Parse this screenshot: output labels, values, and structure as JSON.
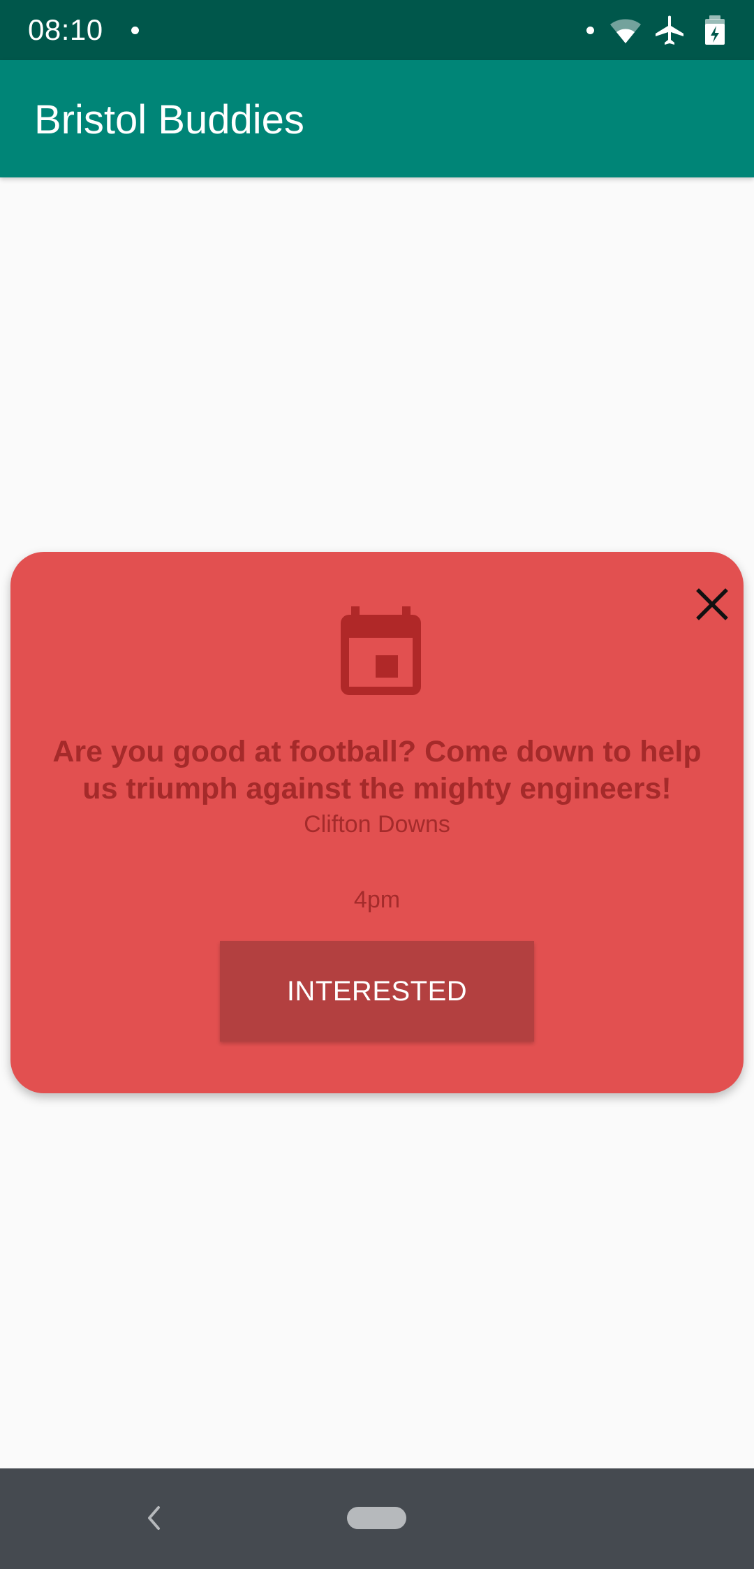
{
  "status_bar": {
    "time": "08:10",
    "icons": [
      "notification-dot-icon",
      "wifi-icon",
      "airplane-icon",
      "battery-icon"
    ]
  },
  "app_bar": {
    "title": "Bristol Buddies"
  },
  "event_card": {
    "icon": "calendar-icon",
    "close_icon": "close-icon",
    "title": "Are you good at football? Come down to help us triumph against the mighty engineers!",
    "location": "Clifton Downs",
    "time": "4pm",
    "button_label": "INTERESTED",
    "colors": {
      "card_background": "#e25050",
      "text": "#a52a2a",
      "button": "#b34040",
      "icon": "#b02828"
    }
  },
  "nav_bar": {
    "back_icon": "back-chevron-icon",
    "home_icon": "home-pill-icon"
  },
  "colors": {
    "status_bar": "#00574b",
    "app_bar": "#008577",
    "background": "#fafafa",
    "nav_bar": "#454a50"
  }
}
